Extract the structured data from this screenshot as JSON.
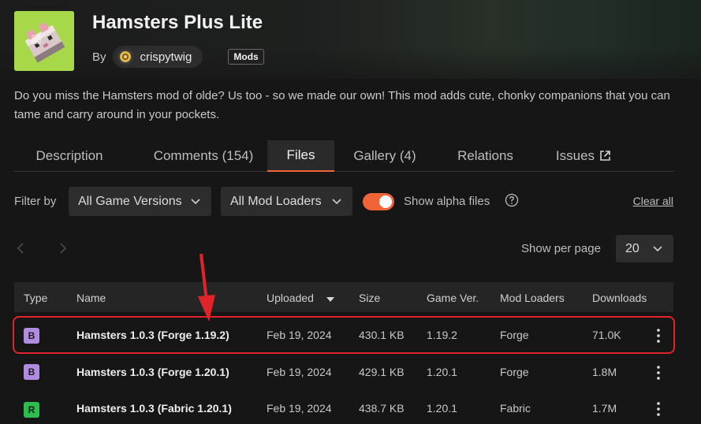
{
  "project": {
    "title": "Hamsters Plus Lite",
    "by_label": "By",
    "author": "crispytwig",
    "tag": "Mods",
    "description": "Do you miss the Hamsters mod of olde? Us too - so we made our own! This mod adds cute, chonky companions that you can tame and carry around in your pockets."
  },
  "tabs": [
    {
      "label": "Description",
      "active": false
    },
    {
      "label": "Comments (154)",
      "active": false
    },
    {
      "label": "Files",
      "active": true
    },
    {
      "label": "Gallery (4)",
      "active": false
    },
    {
      "label": "Relations",
      "active": false
    },
    {
      "label": "Issues",
      "active": false,
      "icon": "external-link-icon"
    }
  ],
  "filters": {
    "label": "Filter by",
    "game_versions": "All Game Versions",
    "mod_loaders": "All Mod Loaders",
    "show_alpha_label": "Show alpha files",
    "show_alpha_on": true,
    "clear_all": "Clear all"
  },
  "pagination": {
    "per_page_label": "Show per page",
    "per_page_value": "20"
  },
  "table": {
    "columns": [
      "Type",
      "Name",
      "Uploaded",
      "Size",
      "Game Ver.",
      "Mod Loaders",
      "Downloads"
    ],
    "rows": [
      {
        "type": "B",
        "name": "Hamsters 1.0.3 (Forge 1.19.2)",
        "uploaded": "Feb 19, 2024",
        "size": "430.1 KB",
        "game_ver": "1.19.2",
        "loader": "Forge",
        "downloads": "71.0K",
        "highlighted": true
      },
      {
        "type": "B",
        "name": "Hamsters 1.0.3 (Forge 1.20.1)",
        "uploaded": "Feb 19, 2024",
        "size": "429.1 KB",
        "game_ver": "1.20.1",
        "loader": "Forge",
        "downloads": "1.8M",
        "highlighted": false
      },
      {
        "type": "R",
        "name": "Hamsters 1.0.3 (Fabric 1.20.1)",
        "uploaded": "Feb 19, 2024",
        "size": "438.7 KB",
        "game_ver": "1.20.1",
        "loader": "Fabric",
        "downloads": "1.7M",
        "highlighted": false
      }
    ]
  },
  "colors": {
    "accent": "#f16436",
    "beta_badge": "#b08ce0",
    "release_badge": "#2dbd4f",
    "annotation": "#e0242a"
  }
}
